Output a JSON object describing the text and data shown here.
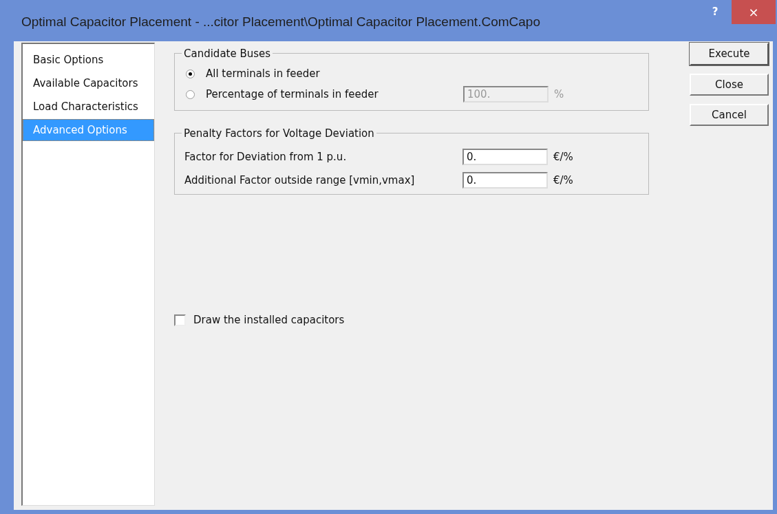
{
  "window": {
    "title": "Optimal Capacitor Placement - ...citor Placement\\Optimal Capacitor Placement.ComCapo",
    "help": "?",
    "close": "×"
  },
  "sidebar": {
    "items": [
      {
        "label": "Basic Options",
        "selected": false
      },
      {
        "label": "Available Capacitors",
        "selected": false
      },
      {
        "label": "Load Characteristics",
        "selected": false
      },
      {
        "label": "Advanced Options",
        "selected": true
      }
    ]
  },
  "candidate_buses": {
    "title": "Candidate Buses",
    "options": [
      {
        "label": "All terminals in feeder",
        "selected": true
      },
      {
        "label": "Percentage of terminals in feeder",
        "selected": false
      }
    ],
    "percentage": {
      "value": "100.",
      "unit": "%",
      "disabled": true
    }
  },
  "penalty": {
    "title": "Penalty Factors for Voltage Deviation",
    "rows": [
      {
        "label": "Factor for Deviation from 1 p.u.",
        "value": "0.",
        "unit": "€/%"
      },
      {
        "label": "Additional Factor outside range [vmin,vmax]",
        "value": "0.",
        "unit": "€/%"
      }
    ]
  },
  "draw_capacitors": {
    "label": "Draw the installed capacitors",
    "checked": false
  },
  "buttons": [
    {
      "label": "Execute",
      "default": true
    },
    {
      "label": "Close",
      "default": false
    },
    {
      "label": "Cancel",
      "default": false
    }
  ]
}
